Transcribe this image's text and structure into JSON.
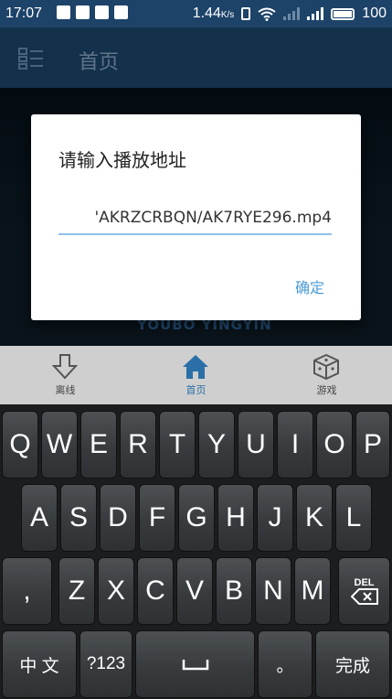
{
  "status_bar": {
    "time": "17:07",
    "speed": "1.44",
    "speed_unit": "K/s",
    "battery": "100"
  },
  "app_bar": {
    "title": "首页",
    "icon": "menu-grid-icon"
  },
  "background": {
    "brand_text": "YOUBO YINGYIN"
  },
  "dialog": {
    "title": "请输入播放地址",
    "input_value": "'AKRZCRBQN/AK7RYE296.mp4",
    "confirm_label": "确定"
  },
  "bottom_nav": {
    "items": [
      {
        "label": "离线",
        "icon": "download-arrow-icon"
      },
      {
        "label": "首页",
        "icon": "home-icon",
        "active": true
      },
      {
        "label": "游戏",
        "icon": "dice-icon"
      }
    ]
  },
  "keyboard": {
    "row1": [
      "Q",
      "W",
      "E",
      "R",
      "T",
      "Y",
      "U",
      "I",
      "O",
      "P"
    ],
    "row2": [
      "A",
      "S",
      "D",
      "F",
      "G",
      "H",
      "J",
      "K",
      "L"
    ],
    "row3": [
      ",",
      "Z",
      "X",
      "C",
      "V",
      "B",
      "N",
      "M"
    ],
    "del_label": "DEL",
    "lang_label": "中 文",
    "num_label": "?123",
    "period_label": "。",
    "done_label": "完成"
  },
  "colors": {
    "status_bar": "#1d4368",
    "app_bar": "#1b4266",
    "accent": "#4a9bd6"
  }
}
